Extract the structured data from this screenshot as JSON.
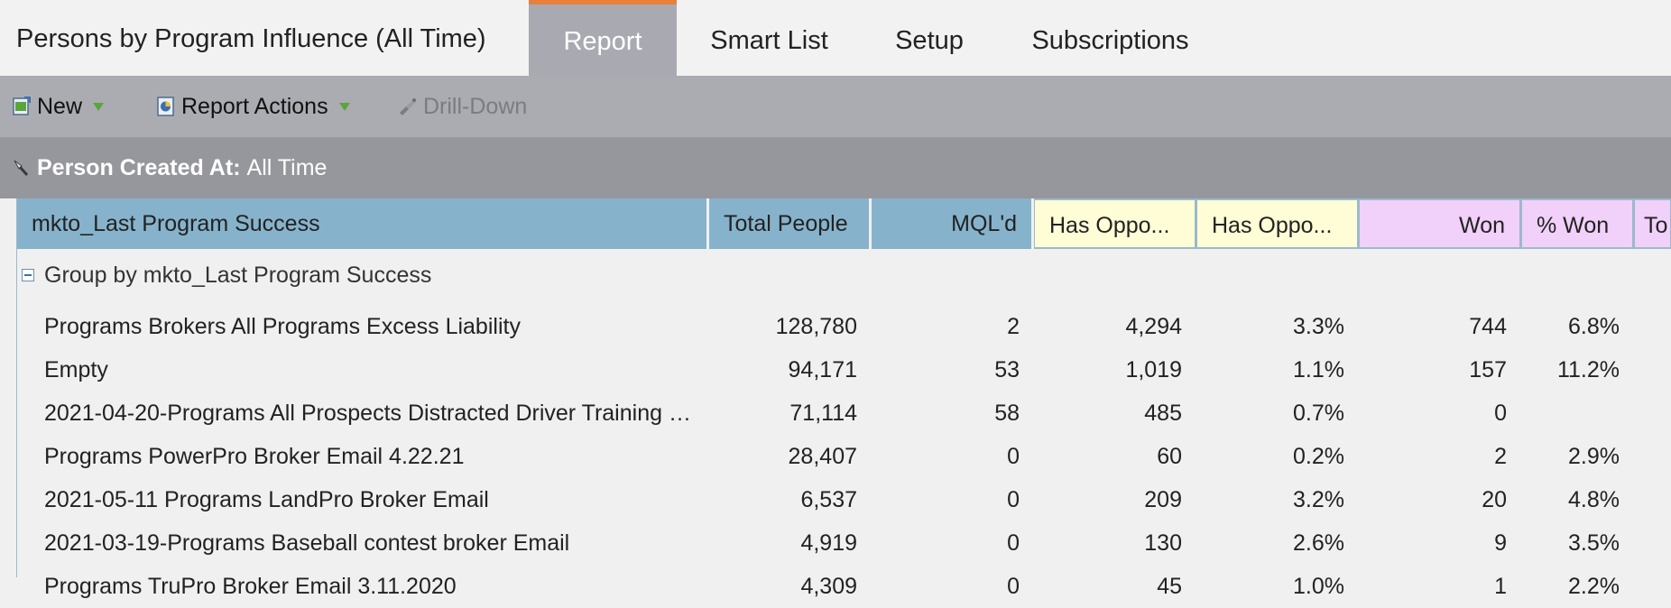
{
  "header": {
    "title": "Persons by Program Influence (All Time)",
    "tabs": [
      "Report",
      "Smart List",
      "Setup",
      "Subscriptions"
    ]
  },
  "toolbar": {
    "new_label": "New",
    "report_actions_label": "Report Actions",
    "drill_down_label": "Drill-Down"
  },
  "filter": {
    "label": "Person Created At:",
    "value": "All Time"
  },
  "table": {
    "columns": [
      "mkto_Last Program Success",
      "Total People",
      "MQL'd",
      "Has Oppo...",
      "Has Oppo...",
      "Won",
      "% Won",
      "To"
    ],
    "group_label": "Group by mkto_Last Program Success",
    "rows": [
      [
        "Programs Brokers All Programs Excess Liability",
        "128,780",
        "2",
        "4,294",
        "3.3%",
        "744",
        "6.8%"
      ],
      [
        "Empty",
        "94,171",
        "53",
        "1,019",
        "1.1%",
        "157",
        "11.2%"
      ],
      [
        "2021-04-20-Programs All Prospects Distracted Driver Training 4....",
        "71,114",
        "58",
        "485",
        "0.7%",
        "0",
        ""
      ],
      [
        "Programs PowerPro Broker Email 4.22.21",
        "28,407",
        "0",
        "60",
        "0.2%",
        "2",
        "2.9%"
      ],
      [
        "2021-05-11 Programs LandPro Broker Email",
        "6,537",
        "0",
        "209",
        "3.2%",
        "20",
        "4.8%"
      ],
      [
        "2021-03-19-Programs Baseball contest broker Email",
        "4,919",
        "0",
        "130",
        "2.6%",
        "9",
        "3.5%"
      ],
      [
        "Programs TruPro Broker Email 3.11.2020",
        "4,309",
        "0",
        "45",
        "1.0%",
        "1",
        "2.2%"
      ]
    ]
  },
  "colors": {
    "accent_tab": "#e8803c",
    "header_blue": "#86b3cb",
    "header_yellow": "#fefdd6",
    "header_pink": "#f1d0fa"
  },
  "icons": {
    "new": "new-document-icon",
    "report_actions": "report-actions-icon",
    "drill_down": "drill-icon",
    "filter": "filter-wrench-icon"
  }
}
